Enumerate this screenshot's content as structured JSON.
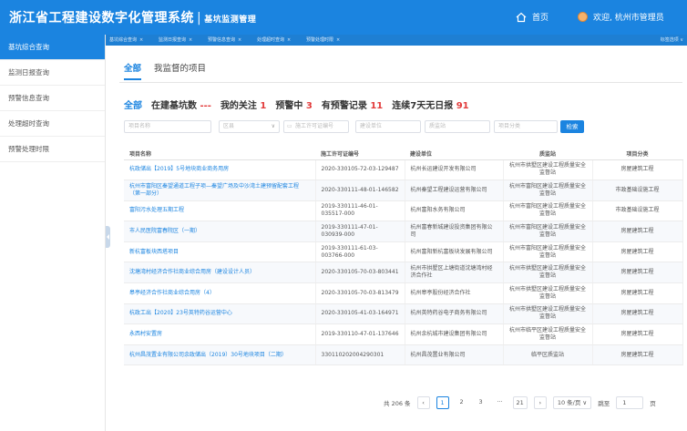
{
  "header": {
    "title": "浙江省工程建设数字化管理系统",
    "separator": "|",
    "subtitle": "基坑监测管理",
    "home_label": "首页",
    "welcome_label": "欢迎, 杭州市管理员",
    "brand_color": "#1b84e0"
  },
  "sidebar": {
    "items": [
      {
        "label": "基坑综合查询",
        "active": true
      },
      {
        "label": "监测日报查询",
        "active": false
      },
      {
        "label": "预警信息查询",
        "active": false
      },
      {
        "label": "处理超时查询",
        "active": false
      },
      {
        "label": "预警处理时限",
        "active": false
      }
    ]
  },
  "tabs": {
    "items": [
      "基坑综合查询",
      "监测日报查询",
      "预警信息查询",
      "处理超时查询",
      "预警处理时限"
    ],
    "close_glyph": "×",
    "menu_label": "标签选项 ∨"
  },
  "scope": {
    "all": "全部",
    "mine": "我监督的项目"
  },
  "stats": {
    "all": "全部",
    "building_label": "在建基坑数",
    "building_value": "---",
    "follow_label": "我的关注",
    "follow_value": "1",
    "warning_label": "预警中",
    "warning_value": "3",
    "record_label": "有预警记录",
    "record_value": "11",
    "nodaily_label": "连续7天无日报",
    "nodaily_value": "91"
  },
  "filters": {
    "name_placeholder": "项目名称",
    "region_placeholder": "区县",
    "permit_placeholder": "施工许可证编号",
    "builder_placeholder": "建设单位",
    "supervisor_placeholder": "质监站",
    "category_placeholder": "项目分类",
    "search_label": "检索"
  },
  "table": {
    "columns": [
      "项目名称",
      "施工许可证编号",
      "建设单位",
      "质监站",
      "项目分类"
    ],
    "rows": [
      [
        "杭政储出【2019】5号地块商业商务用房",
        "2020-330105-72-03-129487",
        "杭州长运建设开发有限公司",
        "杭州市拱墅区建设工程质量安全监督站",
        "房屋建筑工程"
      ],
      [
        "杭州市富阳区秦望通道工程子项—秦望广场及中沙湾土建预留配套工程（第一部分）",
        "2020-330111-48-01-146582",
        "杭州秦望工程建设运营有限公司",
        "杭州市富阳区建设工程质量安全监督站",
        "市政基础设施工程"
      ],
      [
        "富阳污水处理五期工程",
        "2019-330111-46-01-035517-000",
        "杭州富阳水务有限公司",
        "杭州市富阳区建设工程质量安全监督站",
        "市政基础设施工程"
      ],
      [
        "市人民医院富春院区（一期）",
        "2019-330111-47-01-030939-000",
        "杭州富春新城建设投资集团有限公司",
        "杭州市富阳区建设工程质量安全监督站",
        "房屋建筑工程"
      ],
      [
        "新杭富板块西塔项目",
        "2019-330111-61-03-003766-000",
        "杭州富阳新杭富板块发展有限公司",
        "杭州市富阳区建设工程质量安全监督站",
        "房屋建筑工程"
      ],
      [
        "沈塘湾村经济合作社商业综合用房（建设设计人员）",
        "2020-330105-70-03-803441",
        "杭州市拱墅区上塘街道沈塘湾村经济合作社",
        "杭州市拱墅区建设工程质量安全监督站",
        "房屋建筑工程"
      ],
      [
        "皋亭经济合作社商业综合用房（4）",
        "2020-330105-70-03-813479",
        "杭州皋亭股份经济合作社",
        "杭州市拱墅区建设工程质量安全监督站",
        "房屋建筑工程"
      ],
      [
        "杭政工出【2020】23号英特药谷运营中心",
        "2020-330105-41-03-164971",
        "杭州英特药谷电子商务有限公司",
        "杭州市拱墅区建设工程质量安全监督站",
        "房屋建筑工程"
      ],
      [
        "永西村安置房",
        "2019-330110-47-01-137646",
        "杭州余杭城市建设集团有限公司",
        "杭州市临平区建设工程质量安全监督站",
        "房屋建筑工程"
      ],
      [
        "杭州昌茂置业有限公司余政储出（2019）30号地块项目（二期）",
        "330110202004290301",
        "杭州昌茂置业有限公司",
        "临平区质监站",
        "房屋建筑工程"
      ]
    ]
  },
  "pagination": {
    "total": "共 206 条",
    "prev": "‹",
    "pages": [
      "1",
      "2",
      "3",
      "···",
      "21"
    ],
    "next": "›",
    "page_size": "10 条/页 ∨",
    "goto_label": "跳至",
    "goto_value": "1",
    "page_unit": "页"
  }
}
